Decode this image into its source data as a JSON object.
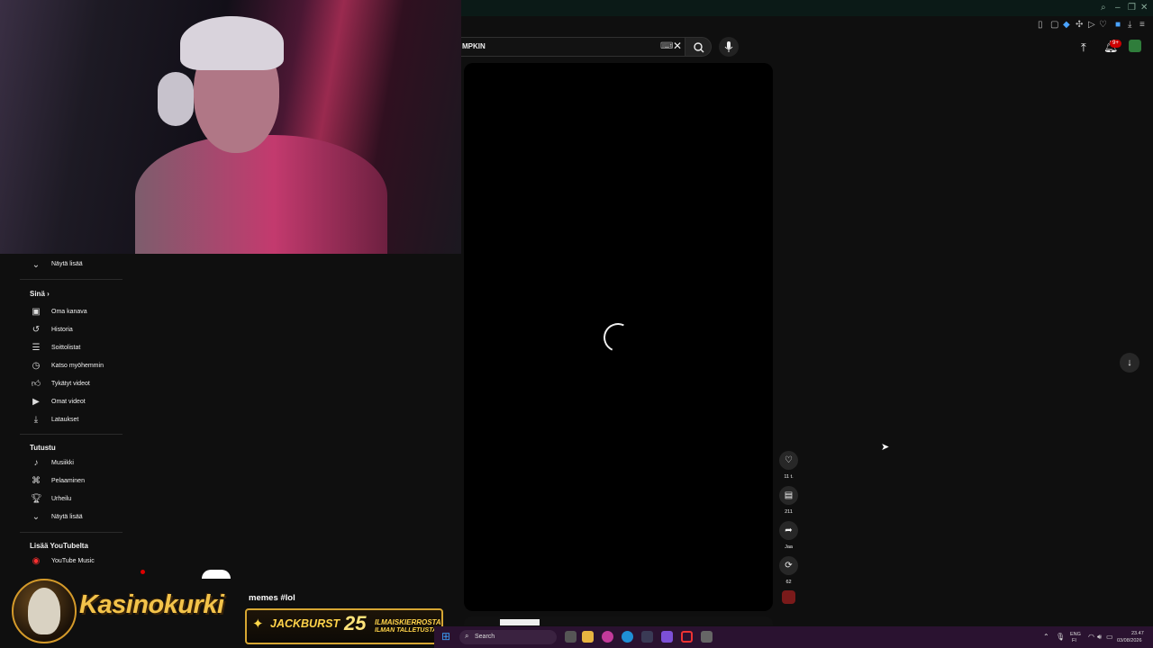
{
  "search": {
    "value": "MPKIN"
  },
  "header": {
    "notification_count": "9+"
  },
  "sidebar": {
    "show_more_1": "Näytä lisää",
    "section_you": "Sinä",
    "you_items": [
      {
        "label": "Oma kanava",
        "icon": "channel-icon"
      },
      {
        "label": "Historia",
        "icon": "history-icon"
      },
      {
        "label": "Soittolistat",
        "icon": "playlists-icon"
      },
      {
        "label": "Katso myöhemmin",
        "icon": "watch-later-icon"
      },
      {
        "label": "Tykätyt videot",
        "icon": "liked-icon"
      },
      {
        "label": "Omat videot",
        "icon": "my-videos-icon"
      },
      {
        "label": "Lataukset",
        "icon": "downloads-icon"
      }
    ],
    "section_explore": "Tutustu",
    "explore_items": [
      {
        "label": "Musiikki",
        "icon": "music-icon"
      },
      {
        "label": "Pelaaminen",
        "icon": "gaming-icon"
      },
      {
        "label": "Urheilu",
        "icon": "sports-icon"
      }
    ],
    "show_more_2": "Näytä lisää",
    "section_more": "Lisää YouTubelta",
    "more_items": [
      {
        "label": "YouTube Music",
        "icon": "youtube-music-icon"
      }
    ]
  },
  "actions": {
    "likes": "11 t.",
    "comments": "211",
    "share": "Jaa",
    "remix": "62"
  },
  "overlay": {
    "caption": "memes #lol",
    "logo_text": "Kasinokurki",
    "promo_main": "JACKBURST",
    "promo_number": "25",
    "promo_line1": "ILMAISKIERROSTA",
    "promo_line2": "ILMAN TALLETUSTA"
  },
  "taskbar": {
    "search_label": "Search",
    "lang_1": "ENG",
    "lang_2": "FI",
    "time": "23.47",
    "date": "03/08/2026"
  },
  "colors": {
    "accent_red": "#cc0000",
    "brand_gold": "#f3c34a",
    "taskbar": "#2a1230"
  }
}
